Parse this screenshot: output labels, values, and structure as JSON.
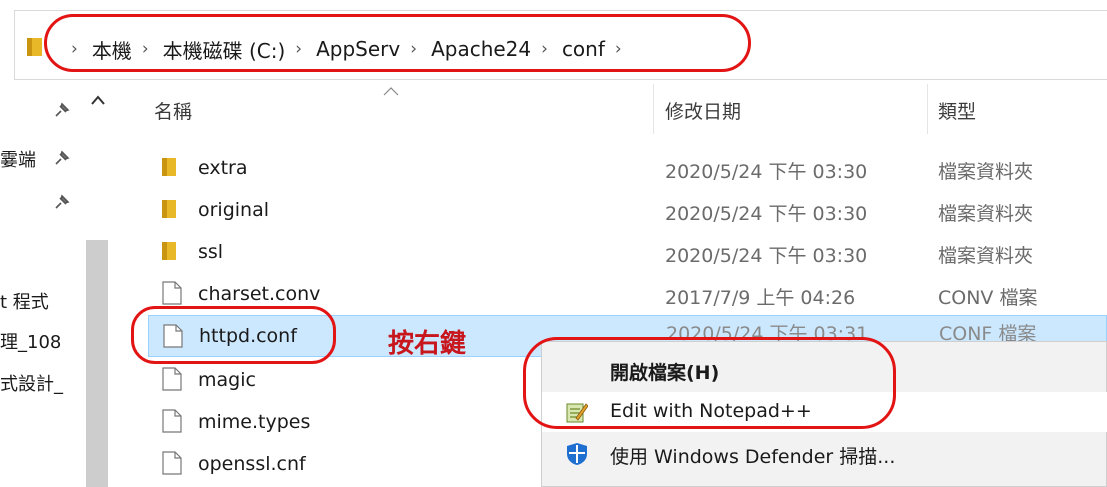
{
  "breadcrumb": {
    "segments": [
      "本機",
      "本機磁碟 (C:)",
      "AppServ",
      "Apache24",
      "conf"
    ]
  },
  "nav": {
    "items": [
      "霎端",
      "t 程式",
      "理_108",
      "式設計_"
    ]
  },
  "columns": {
    "name": "名稱",
    "date": "修改日期",
    "type": "類型"
  },
  "files": [
    {
      "name": "extra",
      "date": "2020/5/24 下午 03:30",
      "type": "檔案資料夾",
      "kind": "folder"
    },
    {
      "name": "original",
      "date": "2020/5/24 下午 03:30",
      "type": "檔案資料夾",
      "kind": "folder"
    },
    {
      "name": "ssl",
      "date": "2020/5/24 下午 03:30",
      "type": "檔案資料夾",
      "kind": "folder"
    },
    {
      "name": "charset.conv",
      "date": "2017/7/9 上午 04:26",
      "type": "CONV 檔案",
      "kind": "file"
    },
    {
      "name": "httpd.conf",
      "date": "2020/5/24 下午 03:31",
      "type": "CONF 檔案",
      "kind": "file"
    },
    {
      "name": "magic",
      "date": "",
      "type": "",
      "kind": "file"
    },
    {
      "name": "mime.types",
      "date": "",
      "type": "",
      "kind": "file"
    },
    {
      "name": "openssl.cnf",
      "date": "",
      "type": "",
      "kind": "file"
    }
  ],
  "context_menu": {
    "items": [
      {
        "label": "開啟檔案(H)",
        "icon": "none",
        "bold": true
      },
      {
        "label": "Edit with Notepad++",
        "icon": "notepad-plus-plus-icon"
      },
      {
        "label": "使用 Windows Defender 掃描...",
        "icon": "windows-defender-shield-icon"
      }
    ]
  },
  "annotation": {
    "text": "按右鍵"
  },
  "colors": {
    "annotation_red": "#e21414",
    "selection_bg": "#cce8ff",
    "folder_yellow": "#e8b829"
  }
}
